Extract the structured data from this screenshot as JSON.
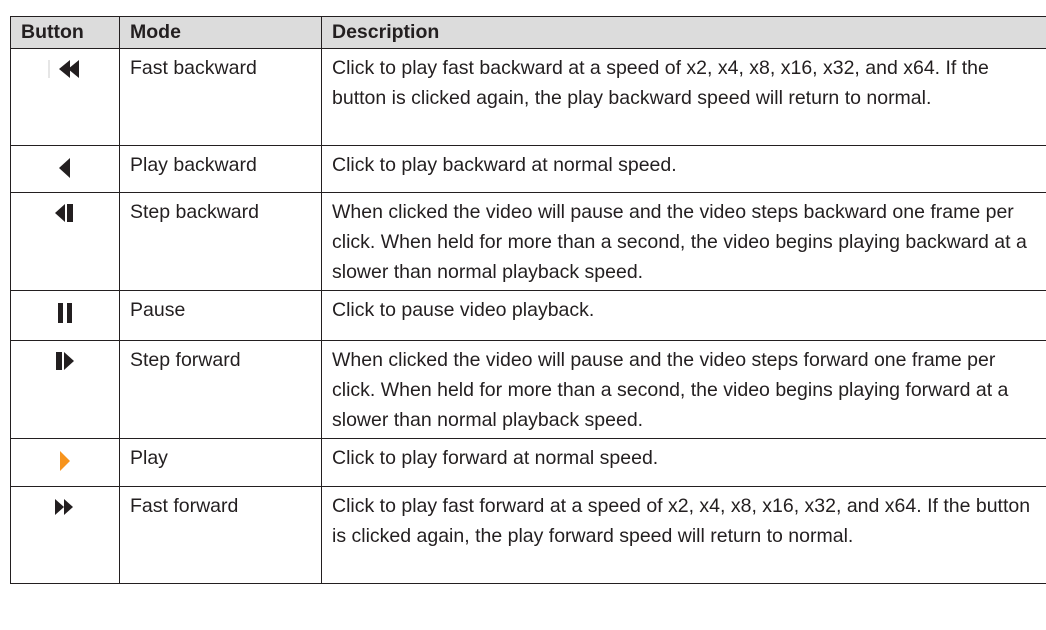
{
  "table": {
    "headers": {
      "button": "Button",
      "mode": "Mode",
      "description": "Description"
    },
    "rows": [
      {
        "icon": "fast-backward-icon",
        "mode": "Fast backward",
        "description": "Click to play fast backward at a speed of x2, x4, x8, x16, x32, and x64. If the button is clicked again, the play backward speed will return to normal."
      },
      {
        "icon": "play-backward-icon",
        "mode": "Play backward",
        "description": "Click to play backward at normal speed."
      },
      {
        "icon": "step-backward-icon",
        "mode": "Step backward",
        "description": "When clicked the video will pause and the video steps backward one frame per click. When held for more than a second, the video begins playing backward at a slower than normal playback speed."
      },
      {
        "icon": "pause-icon",
        "mode": "Pause",
        "description": "Click to pause video playback."
      },
      {
        "icon": "step-forward-icon",
        "mode": "Step forward",
        "description": "When clicked the video will pause and the video steps forward one frame per click. When held for more than a second, the video begins playing forward at a slower than normal playback speed."
      },
      {
        "icon": "play-icon",
        "mode": "Play",
        "description": "Click to play forward at normal speed."
      },
      {
        "icon": "fast-forward-icon",
        "mode": "Fast forward",
        "description": "Click to play fast forward at a speed of x2, x4, x8, x16, x32, and x64. If the button is clicked again, the play forward speed will return to normal."
      }
    ]
  },
  "colors": {
    "header_bg": "#dcdcdc",
    "border": "#231f20",
    "icon_dark": "#231f20",
    "play_accent": "#f7941d"
  }
}
